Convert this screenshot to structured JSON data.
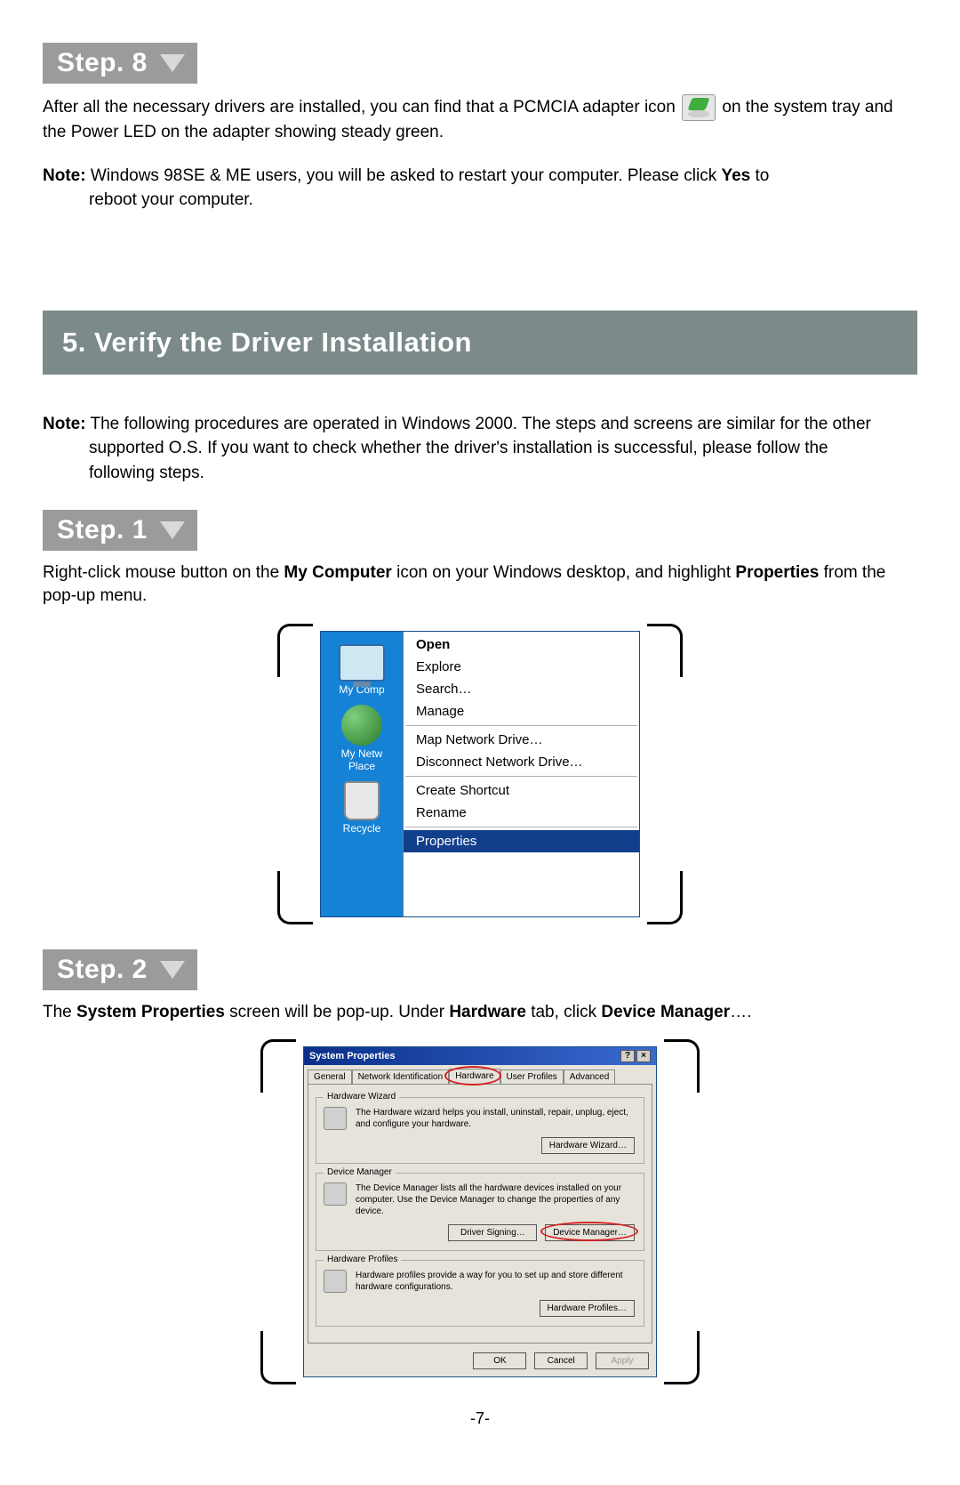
{
  "step8": {
    "badge": "Step. 8",
    "para_before": "After all the necessary drivers are installed, you can find that a PCMCIA adapter icon",
    "para_after": "on the system tray and the Power LED on the adapter showing steady green.",
    "note_label": "Note:",
    "note_line1": "Windows 98SE & ME users, you will be asked to restart your computer. Please click ",
    "note_bold": "Yes",
    "note_line1_tail": " to",
    "note_line2": "reboot your computer."
  },
  "section5": {
    "heading": "5. Verify the Driver Installation",
    "note_label": "Note:",
    "note_body1": "The following procedures are operated in Windows 2000. The steps and screens are similar for the other",
    "note_body2": "supported O.S.  If you want to check whether the driver's installation is successful, please follow the",
    "note_body3": "following steps."
  },
  "step1": {
    "badge": "Step. 1",
    "p_a": "Right-click mouse button on the ",
    "p_b": "My Computer",
    "p_c": " icon on your Windows desktop, and highlight ",
    "p_d": "Properties",
    "p_e": " from the pop-up menu.",
    "desktop": {
      "mycomp": "My Comp",
      "mynet1": "My Netw",
      "mynet2": "Place",
      "recycle": "Recycle"
    },
    "menu": {
      "open": "Open",
      "explore": "Explore",
      "search": "Search…",
      "manage": "Manage",
      "map": "Map Network Drive…",
      "disconnect": "Disconnect Network Drive…",
      "shortcut": "Create Shortcut",
      "rename": "Rename",
      "properties": "Properties"
    }
  },
  "step2": {
    "badge": "Step. 2",
    "p_a": "The ",
    "p_b": "System Properties",
    "p_c": " screen will be pop-up. Under ",
    "p_d": "Hardware",
    "p_e": " tab, click ",
    "p_f": "Device Manager",
    "p_g": "….",
    "dialog": {
      "title": "System Properties",
      "help_btn": "?",
      "close_btn": "×",
      "tabs": {
        "general": "General",
        "network": "Network Identification",
        "hardware": "Hardware",
        "userprofiles": "User Profiles",
        "advanced": "Advanced"
      },
      "hw_wizard": {
        "legend": "Hardware Wizard",
        "text": "The Hardware wizard helps you install, uninstall, repair, unplug, eject, and configure your hardware.",
        "button": "Hardware Wizard…"
      },
      "dev_mgr": {
        "legend": "Device Manager",
        "text": "The Device Manager lists all the hardware devices installed on your computer. Use the Device Manager to change the properties of any device.",
        "button1": "Driver Signing…",
        "button2": "Device Manager…"
      },
      "hw_profiles": {
        "legend": "Hardware Profiles",
        "text": "Hardware profiles provide a way for you to set up and store different hardware configurations.",
        "button": "Hardware Profiles…"
      },
      "footer": {
        "ok": "OK",
        "cancel": "Cancel",
        "apply": "Apply"
      }
    }
  },
  "page_number": "-7-"
}
